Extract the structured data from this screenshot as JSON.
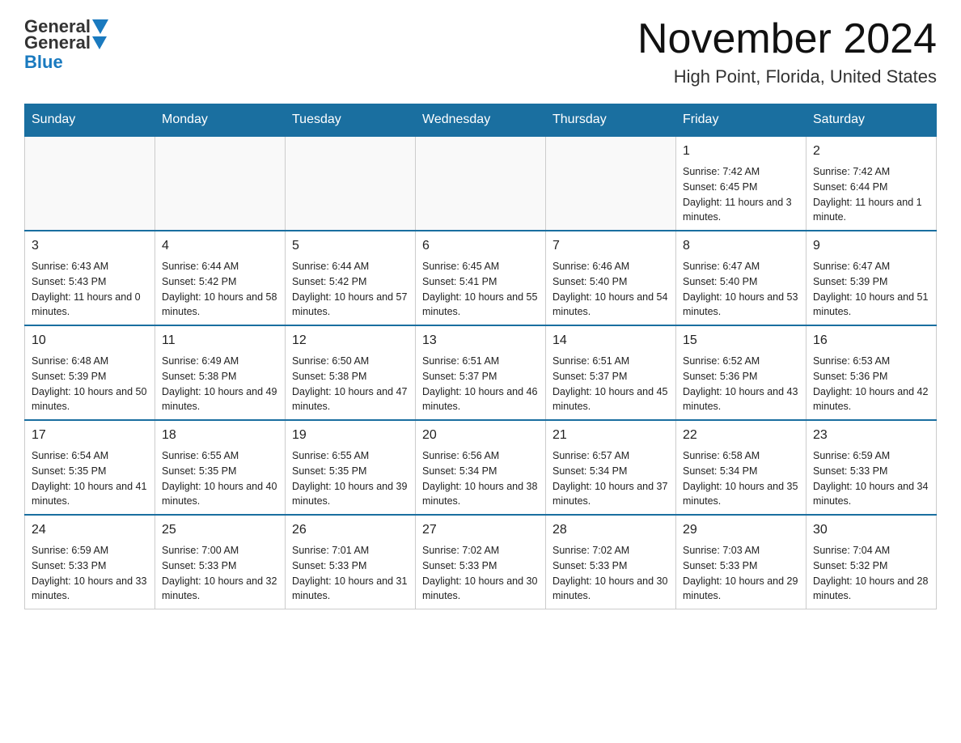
{
  "header": {
    "logo_general": "General",
    "logo_blue": "Blue",
    "month_title": "November 2024",
    "location": "High Point, Florida, United States"
  },
  "days_of_week": [
    "Sunday",
    "Monday",
    "Tuesday",
    "Wednesday",
    "Thursday",
    "Friday",
    "Saturday"
  ],
  "weeks": [
    {
      "days": [
        {
          "number": "",
          "info": ""
        },
        {
          "number": "",
          "info": ""
        },
        {
          "number": "",
          "info": ""
        },
        {
          "number": "",
          "info": ""
        },
        {
          "number": "",
          "info": ""
        },
        {
          "number": "1",
          "info": "Sunrise: 7:42 AM\nSunset: 6:45 PM\nDaylight: 11 hours and 3 minutes."
        },
        {
          "number": "2",
          "info": "Sunrise: 7:42 AM\nSunset: 6:44 PM\nDaylight: 11 hours and 1 minute."
        }
      ]
    },
    {
      "days": [
        {
          "number": "3",
          "info": "Sunrise: 6:43 AM\nSunset: 5:43 PM\nDaylight: 11 hours and 0 minutes."
        },
        {
          "number": "4",
          "info": "Sunrise: 6:44 AM\nSunset: 5:42 PM\nDaylight: 10 hours and 58 minutes."
        },
        {
          "number": "5",
          "info": "Sunrise: 6:44 AM\nSunset: 5:42 PM\nDaylight: 10 hours and 57 minutes."
        },
        {
          "number": "6",
          "info": "Sunrise: 6:45 AM\nSunset: 5:41 PM\nDaylight: 10 hours and 55 minutes."
        },
        {
          "number": "7",
          "info": "Sunrise: 6:46 AM\nSunset: 5:40 PM\nDaylight: 10 hours and 54 minutes."
        },
        {
          "number": "8",
          "info": "Sunrise: 6:47 AM\nSunset: 5:40 PM\nDaylight: 10 hours and 53 minutes."
        },
        {
          "number": "9",
          "info": "Sunrise: 6:47 AM\nSunset: 5:39 PM\nDaylight: 10 hours and 51 minutes."
        }
      ]
    },
    {
      "days": [
        {
          "number": "10",
          "info": "Sunrise: 6:48 AM\nSunset: 5:39 PM\nDaylight: 10 hours and 50 minutes."
        },
        {
          "number": "11",
          "info": "Sunrise: 6:49 AM\nSunset: 5:38 PM\nDaylight: 10 hours and 49 minutes."
        },
        {
          "number": "12",
          "info": "Sunrise: 6:50 AM\nSunset: 5:38 PM\nDaylight: 10 hours and 47 minutes."
        },
        {
          "number": "13",
          "info": "Sunrise: 6:51 AM\nSunset: 5:37 PM\nDaylight: 10 hours and 46 minutes."
        },
        {
          "number": "14",
          "info": "Sunrise: 6:51 AM\nSunset: 5:37 PM\nDaylight: 10 hours and 45 minutes."
        },
        {
          "number": "15",
          "info": "Sunrise: 6:52 AM\nSunset: 5:36 PM\nDaylight: 10 hours and 43 minutes."
        },
        {
          "number": "16",
          "info": "Sunrise: 6:53 AM\nSunset: 5:36 PM\nDaylight: 10 hours and 42 minutes."
        }
      ]
    },
    {
      "days": [
        {
          "number": "17",
          "info": "Sunrise: 6:54 AM\nSunset: 5:35 PM\nDaylight: 10 hours and 41 minutes."
        },
        {
          "number": "18",
          "info": "Sunrise: 6:55 AM\nSunset: 5:35 PM\nDaylight: 10 hours and 40 minutes."
        },
        {
          "number": "19",
          "info": "Sunrise: 6:55 AM\nSunset: 5:35 PM\nDaylight: 10 hours and 39 minutes."
        },
        {
          "number": "20",
          "info": "Sunrise: 6:56 AM\nSunset: 5:34 PM\nDaylight: 10 hours and 38 minutes."
        },
        {
          "number": "21",
          "info": "Sunrise: 6:57 AM\nSunset: 5:34 PM\nDaylight: 10 hours and 37 minutes."
        },
        {
          "number": "22",
          "info": "Sunrise: 6:58 AM\nSunset: 5:34 PM\nDaylight: 10 hours and 35 minutes."
        },
        {
          "number": "23",
          "info": "Sunrise: 6:59 AM\nSunset: 5:33 PM\nDaylight: 10 hours and 34 minutes."
        }
      ]
    },
    {
      "days": [
        {
          "number": "24",
          "info": "Sunrise: 6:59 AM\nSunset: 5:33 PM\nDaylight: 10 hours and 33 minutes."
        },
        {
          "number": "25",
          "info": "Sunrise: 7:00 AM\nSunset: 5:33 PM\nDaylight: 10 hours and 32 minutes."
        },
        {
          "number": "26",
          "info": "Sunrise: 7:01 AM\nSunset: 5:33 PM\nDaylight: 10 hours and 31 minutes."
        },
        {
          "number": "27",
          "info": "Sunrise: 7:02 AM\nSunset: 5:33 PM\nDaylight: 10 hours and 30 minutes."
        },
        {
          "number": "28",
          "info": "Sunrise: 7:02 AM\nSunset: 5:33 PM\nDaylight: 10 hours and 30 minutes."
        },
        {
          "number": "29",
          "info": "Sunrise: 7:03 AM\nSunset: 5:33 PM\nDaylight: 10 hours and 29 minutes."
        },
        {
          "number": "30",
          "info": "Sunrise: 7:04 AM\nSunset: 5:32 PM\nDaylight: 10 hours and 28 minutes."
        }
      ]
    }
  ]
}
